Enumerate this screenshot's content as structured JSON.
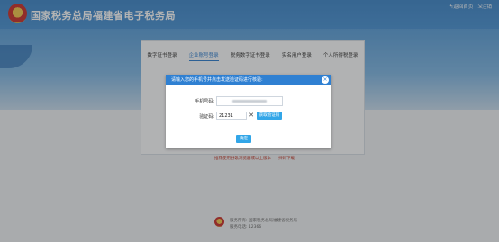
{
  "header": {
    "site_title": "国家税务总局福建省电子税务局",
    "back_home": "↰返回首页",
    "logout": "⇲注销"
  },
  "tabs": [
    {
      "label": "数字证书登录",
      "active": false
    },
    {
      "label": "企业账号登录",
      "active": true
    },
    {
      "label": "税务数字证书登录",
      "active": false
    },
    {
      "label": "实名用户登录",
      "active": false
    },
    {
      "label": "个人所得税登录",
      "active": false
    }
  ],
  "modal": {
    "title": "请输入您的手机号并点击发送验证码进行核验:",
    "phone_label": "手机号码:",
    "code_label": "验证码:",
    "code_value": "21231",
    "get_code_label": "获取验证码",
    "confirm_label": "确定"
  },
  "links": {
    "left": "推荐使用谷歌浏览器或以上版本",
    "right": "扫码下载"
  },
  "footer": {
    "line1": "服务所有: 国家税务总局福建省税务局",
    "line2": "服务电话: 12366"
  },
  "colors": {
    "header_blue": "#3f87c9",
    "modal_head": "#2f80d2",
    "button_blue": "#32a6e8",
    "link_red": "#c0392b"
  }
}
